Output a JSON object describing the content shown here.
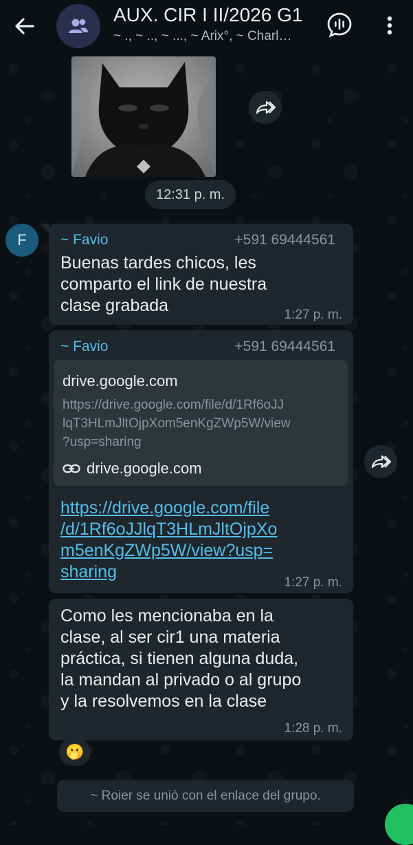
{
  "header": {
    "title": "AUX. CIR I II/2026 G1",
    "subtitle": "~ ., ~ .., ~ ..., ~ Arix°, ~ Charl…"
  },
  "messages": {
    "image_time": "12:31 p. m.",
    "msg1": {
      "avatar_letter": "F",
      "sender": "~ Favio",
      "phone": "+591 69444561",
      "lines": [
        "Buenas tardes chicos, les",
        "comparto el link de nuestra",
        "clase grabada"
      ],
      "time": "1:27 p. m."
    },
    "msg2": {
      "sender": "~ Favio",
      "phone": "+591 69444561",
      "card_title": "drive.google.com",
      "card_url_lines": [
        "https://drive.google.com/file/d/1Rf6oJJ",
        "lqT3HLmJltOjpXom5enKgZWp5W/view",
        "?usp=sharing"
      ],
      "card_domain": "drive.google.com",
      "link_lines": [
        "https://drive.google.com/file",
        "/d/1Rf6oJJlqT3HLmJltOjpXo",
        "m5enKgZWp5W/view?usp=",
        "sharing"
      ],
      "time": "1:27 p. m."
    },
    "msg3": {
      "lines": [
        "Como les mencionaba en la",
        "clase, al ser cir1 una materia",
        "práctica, si tienen alguna duda,",
        "la mandan al privado o al grupo",
        "y la resolvemos en la clase"
      ],
      "time": "1:28 p. m.",
      "reaction": "🫢"
    },
    "system": "~ Roier se unió con el enlace del grupo."
  },
  "icons": {
    "back": "arrow-left-icon",
    "group": "group-avatar-icon",
    "call": "voice-call-icon",
    "more": "more-vert-icon",
    "forward": "forward-icon",
    "link": "link-icon"
  },
  "colors": {
    "background": "#0b1014",
    "bubble": "#1f272c",
    "accent_blue": "#53bdeb",
    "muted": "#8696a0"
  }
}
